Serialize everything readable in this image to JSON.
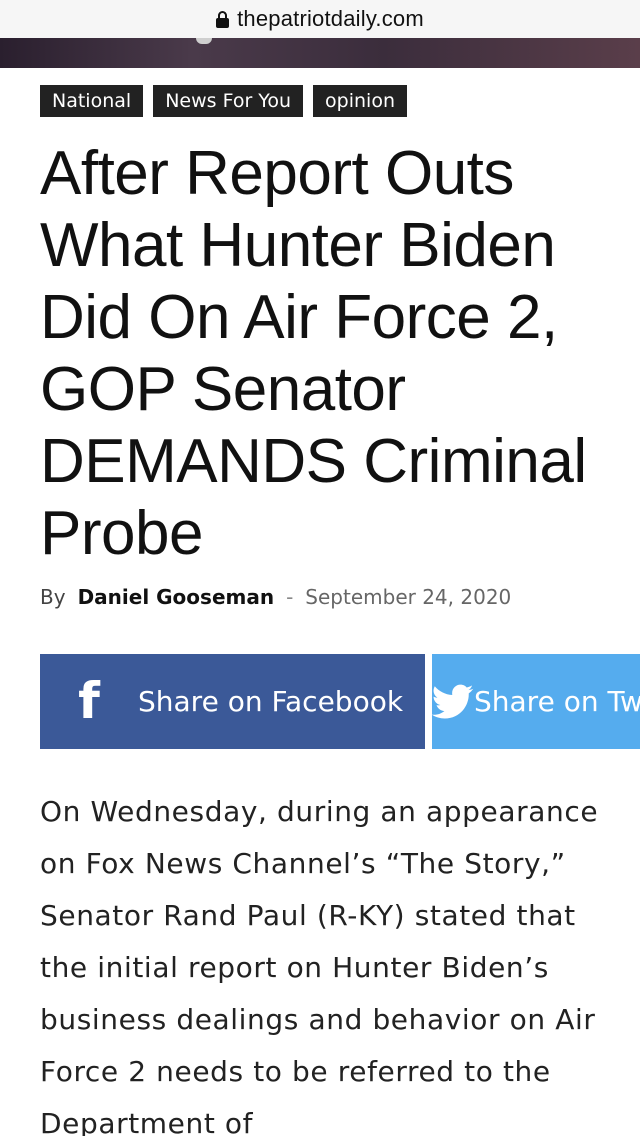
{
  "browser": {
    "url": "thepatriotdaily.com"
  },
  "tags": [
    {
      "label": "National"
    },
    {
      "label": "News For You"
    },
    {
      "label": "opinion"
    }
  ],
  "article": {
    "headline": "After Report Outs What Hunter Biden Did On Air Force 2, GOP Senator DEMANDS Criminal Probe",
    "byline": {
      "by_label": "By",
      "author": "Daniel Gooseman",
      "separator": "-",
      "date": "September 24, 2020"
    },
    "body": "On Wednesday, during an appearance on Fox News Channel’s “The Story,” Senator Rand Paul (R-KY) stated that the initial report on Hunter Biden’s business dealings and behavior on Air Force 2 needs to be referred to the Department of"
  },
  "share": {
    "facebook_label": "Share on Facebook",
    "twitter_label": "Share on Twitter",
    "facebook_color": "#3b5998",
    "twitter_color": "#55acee",
    "facebook_icon": "facebook-icon",
    "twitter_icon": "twitter-icon"
  }
}
